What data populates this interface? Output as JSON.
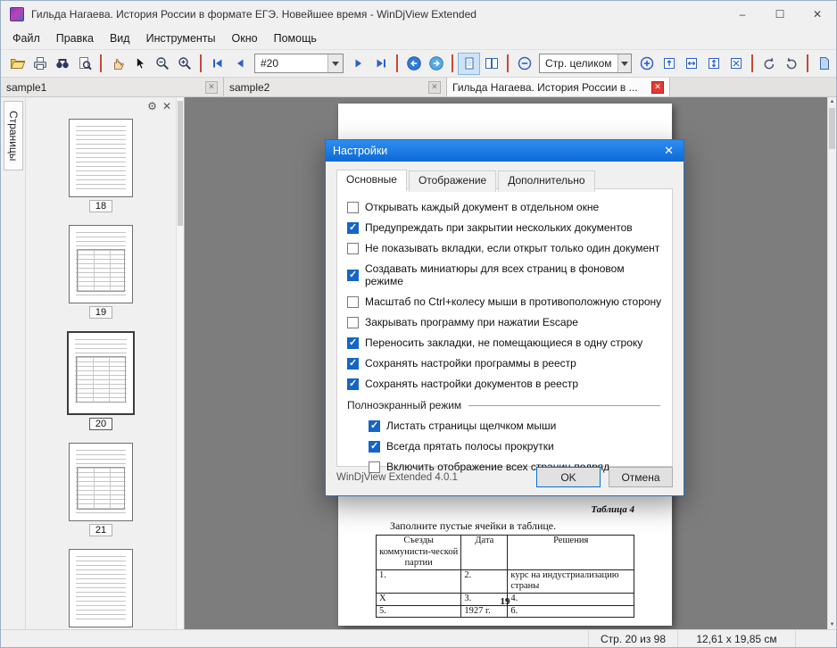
{
  "window": {
    "title": "Гильда Нагаева. История России в формате ЕГЭ. Новейшее время - WinDjView Extended"
  },
  "menu": {
    "items": [
      "Файл",
      "Правка",
      "Вид",
      "Инструменты",
      "Окно",
      "Помощь"
    ]
  },
  "toolbar": {
    "page_combo": "#20",
    "zoom_combo": "Стр. целиком"
  },
  "doc_tabs": [
    {
      "label": "sample1",
      "active": false
    },
    {
      "label": "sample2",
      "active": false
    },
    {
      "label": "Гильда Нагаева. История России в ...",
      "active": true
    }
  ],
  "sidebar": {
    "tab": "Страницы",
    "pages": [
      "18",
      "19",
      "20",
      "21"
    ],
    "current_page": "20"
  },
  "document": {
    "instruction": "Заполните пустые ячейки в таблице.",
    "table_caption": "Таблица 4",
    "table": {
      "headers": [
        "Съезды коммунисти-ческой партии",
        "Дата",
        "Решения"
      ],
      "rows": [
        [
          "1.",
          "2.",
          "курс на индустриализацию страны"
        ],
        [
          "X",
          "3.",
          "4."
        ],
        [
          "5.",
          "1927 г.",
          "6."
        ]
      ]
    },
    "page_number": "19"
  },
  "dialog": {
    "title": "Настройки",
    "tabs": [
      "Основные",
      "Отображение",
      "Дополнительно"
    ],
    "checkboxes": [
      {
        "label": "Открывать каждый документ в отдельном окне",
        "checked": false
      },
      {
        "label": "Предупреждать при закрытии нескольких документов",
        "checked": true
      },
      {
        "label": "Не показывать вкладки, если открыт только один документ",
        "checked": false
      },
      {
        "label": "Создавать миниатюры для всех страниц в фоновом режиме",
        "checked": true
      },
      {
        "label": "Масштаб по Ctrl+колесу мыши в противоположную сторону",
        "checked": false
      },
      {
        "label": "Закрывать программу при нажатии Escape",
        "checked": false
      },
      {
        "label": "Переносить закладки, не помещающиеся в одну строку",
        "checked": true
      },
      {
        "label": "Сохранять настройки программы в реестр",
        "checked": true
      },
      {
        "label": "Сохранять настройки документов в реестр",
        "checked": true
      }
    ],
    "fullscreen": {
      "label": "Полноэкранный режим",
      "items": [
        {
          "label": "Листать страницы щелчком мыши",
          "checked": true
        },
        {
          "label": "Всегда прятать полосы прокрутки",
          "checked": true
        },
        {
          "label": "Включить отображение всех страниц подряд",
          "checked": false
        }
      ]
    },
    "version": "WinDjView Extended 4.0.1",
    "ok_label": "OK",
    "cancel_label": "Отмена"
  },
  "status": {
    "page": "Стр. 20 из 98",
    "size": "12,61 x 19,85 см"
  },
  "icons": {
    "minimize": "–",
    "maximize": "☐",
    "close": "✕",
    "gear": "⚙",
    "panel_close": "✕",
    "dialog_close": "✕",
    "scroll_up": "▲",
    "scroll_down": "▼"
  }
}
